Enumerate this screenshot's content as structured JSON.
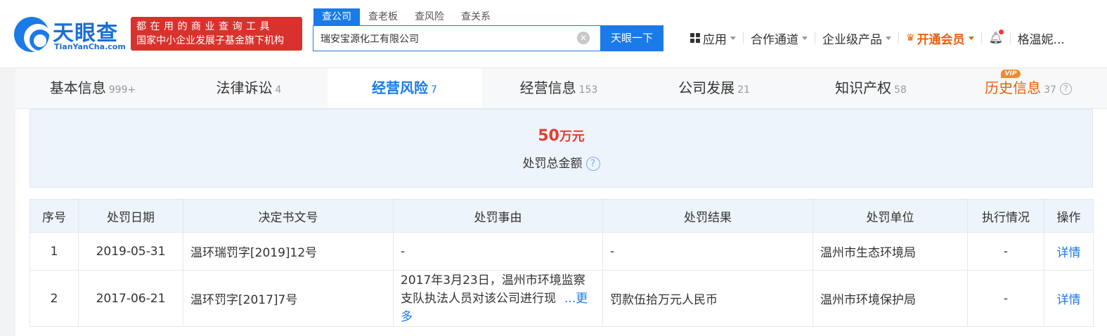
{
  "header": {
    "logo_cn": "天眼查",
    "logo_en": "TianYanCha.com",
    "slogan_line1": "都在用的商业查询工具",
    "slogan_line2": "国家中小企业发展子基金旗下机构",
    "search_tabs": [
      "查公司",
      "查老板",
      "查风险",
      "查关系"
    ],
    "search_value": "瑞安宝源化工有限公司",
    "search_button": "天眼一下",
    "nav": {
      "apps": "应用",
      "channel": "合作通道",
      "enterprise": "企业级产品",
      "vip": "开通会员",
      "user": "格温妮..."
    }
  },
  "tabs": [
    {
      "label": "基本信息",
      "count": "999+"
    },
    {
      "label": "法律诉讼",
      "count": "4"
    },
    {
      "label": "经营风险",
      "count": "7"
    },
    {
      "label": "经营信息",
      "count": "153"
    },
    {
      "label": "公司发展",
      "count": "21"
    },
    {
      "label": "知识产权",
      "count": "58"
    },
    {
      "label": "历史信息",
      "count": "37",
      "badge": "VIP"
    }
  ],
  "summary": {
    "amount": "50",
    "unit": "万元",
    "label": "处罚总金额"
  },
  "table": {
    "headers": [
      "序号",
      "处罚日期",
      "决定书文号",
      "处罚事由",
      "处罚结果",
      "处罚单位",
      "执行情况",
      "操作"
    ],
    "rows": [
      {
        "no": "1",
        "date": "2019-05-31",
        "doc": "温环瑞罚字[2019]12号",
        "reason": "-",
        "result": "-",
        "org": "温州市生态环境局",
        "status": "-",
        "action": "详情"
      },
      {
        "no": "2",
        "date": "2017-06-21",
        "doc": "温环罚字[2017]7号",
        "reason": "2017年3月23日，温州市环境监察支队执法人员对该公司进行现",
        "reason_more": "...更多",
        "result": "罚款伍拾万元人民币",
        "org": "温州市环境保护局",
        "status": "-",
        "action": "详情"
      }
    ]
  }
}
